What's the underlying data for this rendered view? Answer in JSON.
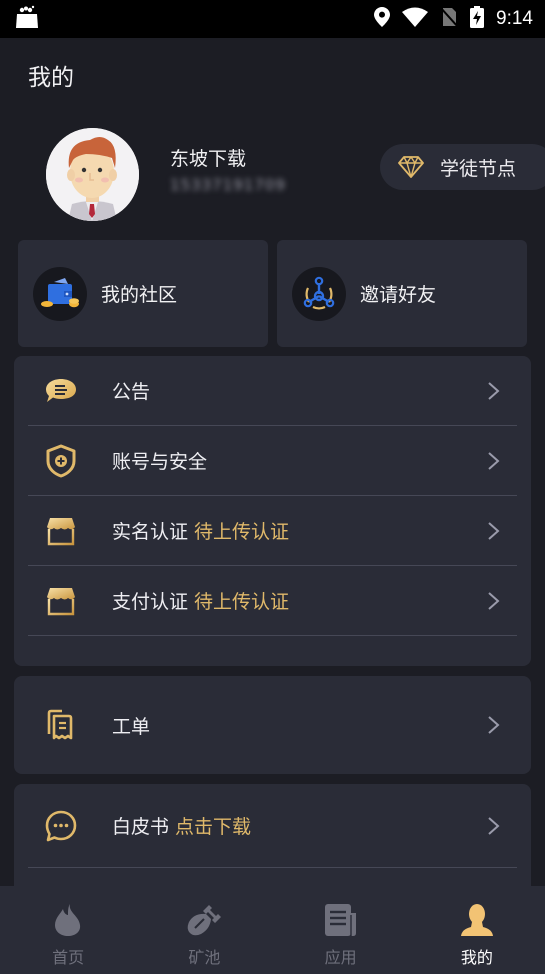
{
  "status_bar": {
    "time": "9:14",
    "icons": [
      "notification-bag-icon",
      "location-icon",
      "wifi-icon",
      "no-sim-icon",
      "battery-charging-icon"
    ]
  },
  "page": {
    "title": "我的"
  },
  "profile": {
    "username": "东坡下载",
    "phone": "15337191709",
    "phone_blurred": true,
    "avatar_icon": "avatar-man-icon",
    "badge": {
      "icon": "diamond-icon",
      "label": "学徒节点"
    }
  },
  "quick_actions": [
    {
      "label": "我的社区",
      "icon": "wallet-icon"
    },
    {
      "label": "邀请好友",
      "icon": "network-share-icon"
    }
  ],
  "menu_groups": [
    {
      "items": [
        {
          "label": "公告",
          "accent": "",
          "icon": "announcement-bubble-icon"
        },
        {
          "label": "账号与安全",
          "accent": "",
          "icon": "shield-plus-icon"
        },
        {
          "label": "实名认证",
          "accent": "待上传认证",
          "icon": "storefront-icon"
        },
        {
          "label": "支付认证",
          "accent": "待上传认证",
          "icon": "storefront-icon"
        }
      ]
    },
    {
      "items": [
        {
          "label": "工单",
          "accent": "",
          "icon": "ticket-documents-icon"
        }
      ]
    },
    {
      "items": [
        {
          "label": "白皮书",
          "accent": "点击下载",
          "icon": "chat-dots-icon"
        }
      ]
    }
  ],
  "tab_bar": {
    "active_index": 3,
    "tabs": [
      {
        "label": "首页",
        "icon": "flame-icon"
      },
      {
        "label": "矿池",
        "icon": "shovel-icon"
      },
      {
        "label": "应用",
        "icon": "news-icon"
      },
      {
        "label": "我的",
        "icon": "user-icon"
      }
    ]
  },
  "colors": {
    "background": "#1c1d24",
    "card": "#2a2c37",
    "accent_gold": "#e0b96a",
    "tab_inactive": "#6f707c",
    "tab_active_icon": "#f2c374",
    "icon_blue": "#2f6fe0"
  }
}
